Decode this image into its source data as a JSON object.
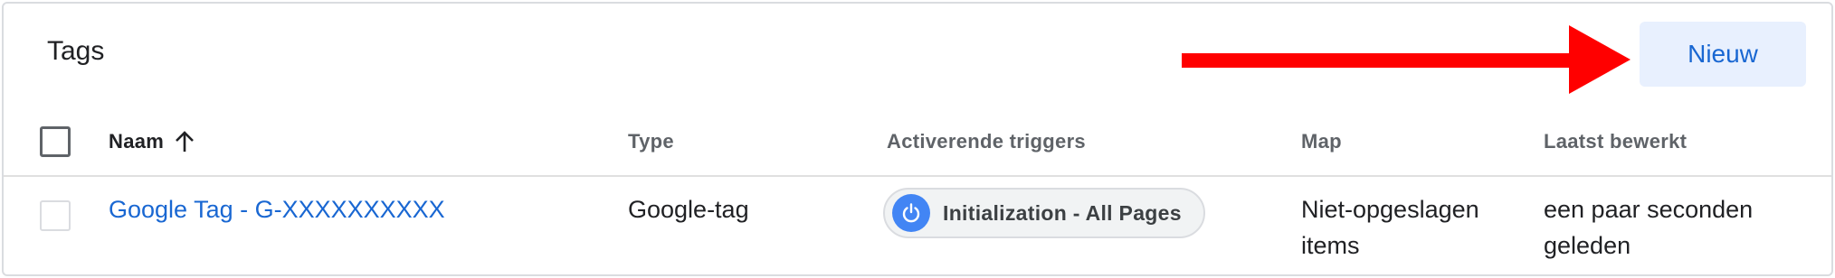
{
  "card": {
    "title": "Tags",
    "new_button_label": "Nieuw"
  },
  "annotation": {
    "arrow_color": "#ff0000",
    "arrow_direction": "right"
  },
  "table": {
    "columns": [
      {
        "label": "Naam",
        "sort_icon": "arrow-up-icon"
      },
      {
        "label": "Type"
      },
      {
        "label": "Activerende triggers"
      },
      {
        "label": "Map"
      },
      {
        "label": "Laatst bewerkt"
      }
    ],
    "rows": [
      {
        "name": "Google Tag - G-XXXXXXXXXX",
        "type": "Google-tag",
        "trigger": {
          "label": "Initialization - All Pages",
          "icon": "power-icon"
        },
        "folder_line1": "Niet-opgeslagen",
        "folder_line2": "items",
        "last_edited_line1": "een paar seconden",
        "last_edited_line2": "geleden"
      }
    ]
  },
  "colors": {
    "accent": "#1967d2",
    "button_bg": "#e8f0fe",
    "trigger_icon_bg": "#4285f4"
  }
}
